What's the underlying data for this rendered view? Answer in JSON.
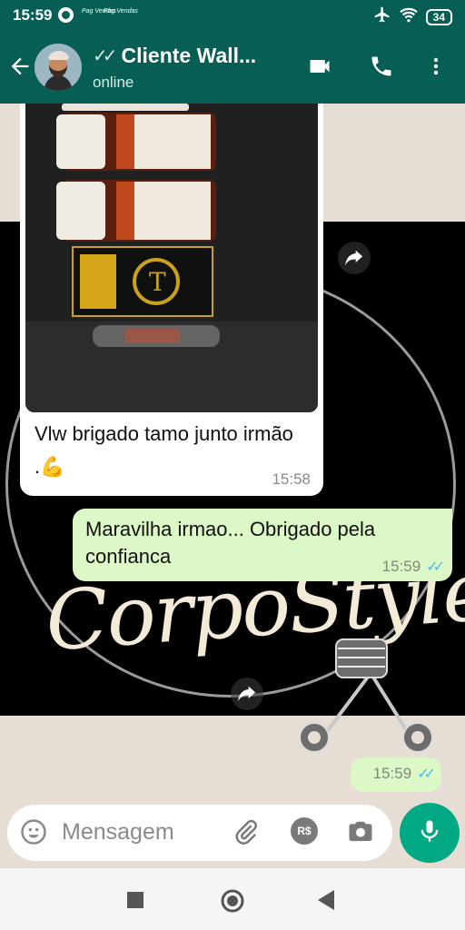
{
  "status_bar": {
    "time": "15:59",
    "notif_1": "Pag Vendas",
    "notif_2": "Pag Vendas",
    "battery": "34",
    "icons": [
      "whatsapp-icon",
      "airplane-icon",
      "wifi-icon",
      "battery-icon"
    ]
  },
  "header": {
    "contact_name": "Cliente Wall...",
    "presence": "online",
    "icons": [
      "back-arrow-icon",
      "video-call-icon",
      "voice-call-icon",
      "more-options-icon"
    ]
  },
  "messages": {
    "incoming": {
      "text": "Vlw brigado tamo junto irmão .💪",
      "time": "15:58"
    },
    "outgoing": {
      "text": "Maravilha irmao... Obrigado pela confianca",
      "time": "15:59",
      "status": "read"
    },
    "outgoing_2": {
      "time": "15:59",
      "status": "read"
    }
  },
  "wallpaper": {
    "watermark_text": "CorpoStyles"
  },
  "input": {
    "placeholder": "Mensagem",
    "icons": [
      "emoji-icon",
      "attach-icon",
      "payment-icon",
      "camera-icon",
      "mic-icon"
    ],
    "payment_label": "R$"
  },
  "nav_bar": {
    "icons": [
      "recents-icon",
      "home-icon",
      "back-icon"
    ]
  },
  "colors": {
    "header": "#075e54",
    "outgoing_bubble": "#dcf8c6",
    "incoming_bubble": "#ffffff",
    "mic_button": "#00a884",
    "read_ticks": "#4fb6ec"
  }
}
